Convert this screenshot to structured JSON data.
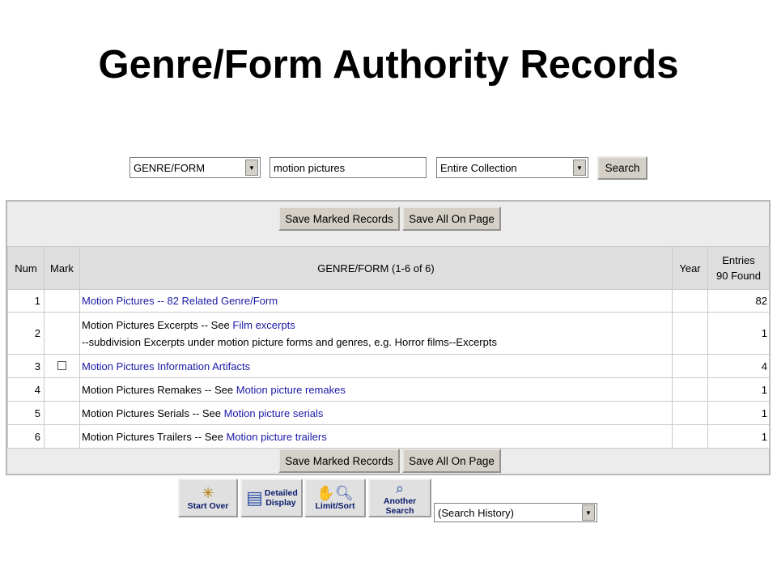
{
  "title": "Genre/Form Authority Records",
  "search": {
    "index_value": "GENRE/FORM",
    "query_value": "motion pictures",
    "scope_value": "Entire Collection",
    "search_label": "Search"
  },
  "actions": {
    "save_marked": "Save Marked Records",
    "save_all": "Save All On Page"
  },
  "table": {
    "headers": {
      "num": "Num",
      "mark": "Mark",
      "heading": "GENRE/FORM (1-6 of 6)",
      "year": "Year",
      "entries_line1": "Entries",
      "entries_line2": "90 Found"
    },
    "rows": [
      {
        "num": "1",
        "plain": "",
        "link": "Motion Pictures -- 82 Related Genre/Form",
        "note": "",
        "entries": "82",
        "mark": false
      },
      {
        "num": "2",
        "plain": "Motion Pictures Excerpts -- See ",
        "link": "Film excerpts",
        "note": "--subdivision Excerpts under motion picture forms and genres, e.g. Horror films--Excerpts",
        "entries": "1",
        "mark": false
      },
      {
        "num": "3",
        "plain": "",
        "link": "Motion Pictures Information Artifacts",
        "note": "",
        "entries": "4",
        "mark": true
      },
      {
        "num": "4",
        "plain": "Motion Pictures Remakes -- See ",
        "link": "Motion picture remakes",
        "note": "",
        "entries": "1",
        "mark": false
      },
      {
        "num": "5",
        "plain": "Motion Pictures Serials -- See ",
        "link": "Motion picture serials",
        "note": "",
        "entries": "1",
        "mark": false
      },
      {
        "num": "6",
        "plain": "Motion Pictures Trailers -- See ",
        "link": "Motion picture trailers",
        "note": "",
        "entries": "1",
        "mark": false
      }
    ]
  },
  "tools": {
    "start_over": "Start Over",
    "detailed_display": "Detailed Display",
    "limit_sort": "Limit/Sort",
    "another_search": "Another Search",
    "history_value": "(Search History)"
  }
}
